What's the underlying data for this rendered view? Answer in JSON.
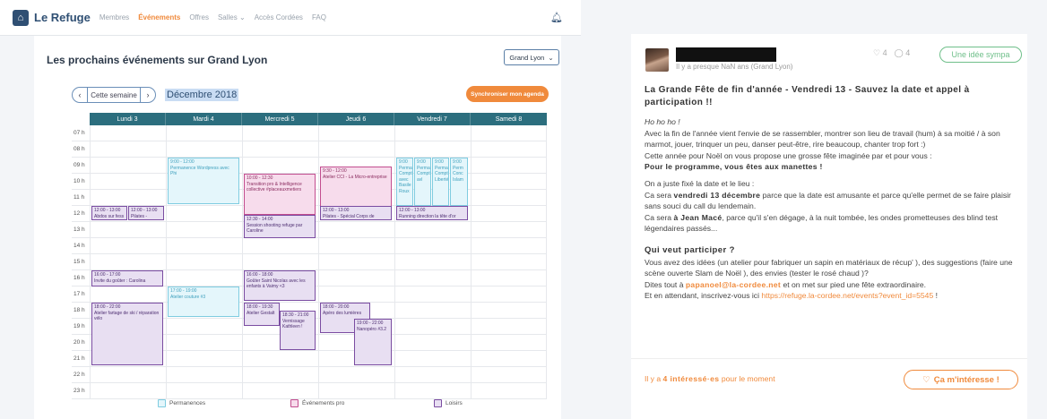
{
  "nav": {
    "brand": "Le Refuge",
    "items": [
      "Membres",
      "Événements",
      "Offres",
      "Salles ⌄",
      "Accès Cordées",
      "FAQ"
    ],
    "active_index": 1
  },
  "calendar": {
    "title": "Les prochains événements sur Grand Lyon",
    "region": "Grand Lyon",
    "this_week": "Cette semaine",
    "month": "Décembre 2018",
    "sync_button": "Synchroniser mon agenda",
    "days": [
      "Lundi 3",
      "Mardi 4",
      "Mercredi 5",
      "Jeudi 6",
      "Vendredi 7",
      "Samedi 8"
    ],
    "hours": [
      "07 h",
      "08 h",
      "09 h",
      "10 h",
      "11 h",
      "12 h",
      "13 h",
      "14 h",
      "15 h",
      "16 h",
      "17 h",
      "18 h",
      "19 h",
      "20 h",
      "21 h",
      "22 h",
      "23 h"
    ],
    "events": [
      {
        "time": "9:00 - 12:00",
        "title": "Permanence Wordpress avec Phi",
        "kind": "blue"
      },
      {
        "time": "10:00 - 12:30",
        "title": "Transition pro & Intelligence collective #placeauxmetiers",
        "kind": "pink"
      },
      {
        "time": "9:30 - 12:00",
        "title": "Atelier CCI - La Micro-entreprise",
        "kind": "pink"
      },
      {
        "time": "9:00",
        "title": "Perma Compt avec Basile Roux",
        "kind": "blue"
      },
      {
        "time": "9:00",
        "title": "Perma Compt avl",
        "kind": "blue"
      },
      {
        "time": "9:00",
        "title": "Perma Compt Liberté",
        "kind": "blue"
      },
      {
        "time": "9:00",
        "title": "Perm Conc Islam",
        "kind": "blue"
      },
      {
        "time": "12:00 - 13:00",
        "title": "Abdos sur fess",
        "kind": "purple"
      },
      {
        "time": "12:00 - 13:00",
        "title": "Pilates -",
        "kind": "purple"
      },
      {
        "time": "12:30 - 14:00",
        "title": "Session shooting refuge par Caroline",
        "kind": "pink"
      },
      {
        "time": "12:00 - 13:00",
        "title": "Pilates - Spécial Corps de",
        "kind": "purple"
      },
      {
        "time": "12:00 - 13:00",
        "title": "Running direction la tête d'or",
        "kind": "purple"
      },
      {
        "time": "16:00 - 17:00",
        "title": "Invite du goûter : Carolina",
        "kind": "purple"
      },
      {
        "time": "16:00 - 18:00",
        "title": "Goûter Saint Nicolas avec les enfants à Vaimy <3",
        "kind": "purple"
      },
      {
        "time": "17:00 - 19:00",
        "title": "Atelier couture #3",
        "kind": "blue"
      },
      {
        "time": "18:00 - 22:00",
        "title": "Atelier fartage de ski / réparation vélo",
        "kind": "purple"
      },
      {
        "time": "18:00 - 19:30",
        "title": "Atelier Gestalt",
        "kind": "purple"
      },
      {
        "time": "18:30 - 21:00",
        "title": "Vernissage Kathleen !",
        "kind": "purple"
      },
      {
        "time": "18:00 - 20:00",
        "title": "Apéro des lumières",
        "kind": "purple"
      },
      {
        "time": "19:00 - 22:00",
        "title": "Nanopéro #3.2",
        "kind": "purple"
      }
    ],
    "legend": [
      "Permanences",
      "Événements pro",
      "Loisirs"
    ]
  },
  "post": {
    "meta": "Il y a presque NaN ans (Grand Lyon)",
    "likes": "4",
    "comments": "4",
    "tag": "Une idée sympa",
    "title": "La Grande Fête de fin d'année - Vendredi 13 - Sauvez la date et appel à participation !!",
    "p1": "Ho ho ho !",
    "p2": "Avec la fin de l'année vient l'envie de se rassembler, montrer son lieu de travail (hum) à sa moitié / à son marmot, jouer, trinquer un peu, danser peut-être, rire beaucoup, chanter trop fort :)",
    "p3": "Cette année pour Noël on vous propose une grosse fête imaginée par et pour vous :",
    "p4": "Pour le programme, vous êtes aux manettes !",
    "p5": "On a juste fixé la date et le lieu :",
    "p6a": "Ca sera ",
    "p6b": "vendredi 13 décembre",
    "p6c": " parce que la date est amusante et parce qu'elle permet de se faire plaisir sans souci du call du lendemain.",
    "p7a": "Ca sera ",
    "p7b": "à Jean Macé",
    "p7c": ", parce qu'il s'en dégage, à la nuit tombée, les ondes prometteuses des blind test légendaires passés...",
    "h2": "Qui veut participer ?",
    "p8": "Vous avez des idées (un atelier pour fabriquer un sapin en matériaux de récup' ), des suggestions (faire une scène ouverte Slam de Noël ), des envies (tester le rosé chaud )?",
    "p9a": "Dites tout à ",
    "p9b": "papanoel@la-cordee.net",
    "p9c": " et on met sur pied une fête extraordinaire.",
    "p10a": "Et en attendant, inscrivez-vous ici ",
    "p10b": "https://refuge.la-cordee.net/events?event_id=5545",
    "p10c": " !",
    "foot_a": "Il y a ",
    "foot_b": "4 intéressé·es",
    "foot_c": " pour le moment",
    "interest_button": "Ça m'intéresse !"
  }
}
